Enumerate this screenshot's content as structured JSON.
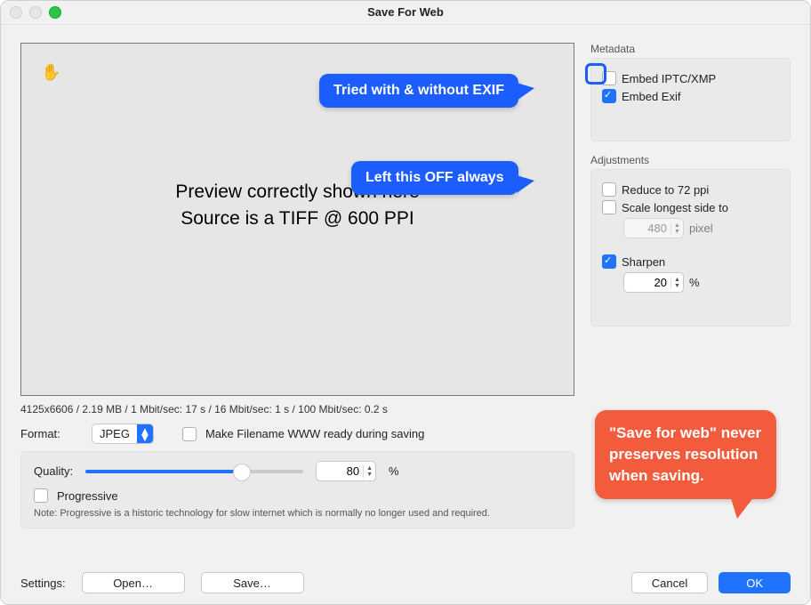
{
  "window_title": "Save For Web",
  "preview": {
    "line1": "Preview correctly shown here",
    "line2": "Source is a TIFF @ 600 PPI"
  },
  "status_line": "4125x6606 / 2.19 MB / 1 Mbit/sec: 17 s / 16 Mbit/sec: 1 s / 100 Mbit/sec: 0.2 s",
  "format": {
    "label": "Format:",
    "value": "JPEG",
    "www_checkbox": "Make Filename WWW ready during saving"
  },
  "quality": {
    "label": "Quality:",
    "value": "80",
    "percent": "%",
    "fill_pct": 72,
    "progressive": "Progressive",
    "note": "Note: Progressive is a historic technology for slow internet which is normally no longer used and required."
  },
  "settings": {
    "label": "Settings:",
    "open": "Open…",
    "save": "Save…"
  },
  "buttons": {
    "cancel": "Cancel",
    "ok": "OK"
  },
  "metadata": {
    "title": "Metadata",
    "iptc": "Embed IPTC/XMP",
    "exif": "Embed Exif"
  },
  "adjustments": {
    "title": "Adjustments",
    "reduce": "Reduce to 72 ppi",
    "scale": "Scale longest side to",
    "pixel_value": "480",
    "pixel_unit": "pixel",
    "sharpen": "Sharpen",
    "sharpen_value": "20",
    "sharpen_unit": "%"
  },
  "annotations": {
    "exif_note": "Tried with & without EXIF",
    "adjust_note": "Left this OFF always",
    "save_note": "\"Save for web\" never preserves resolution when saving."
  }
}
